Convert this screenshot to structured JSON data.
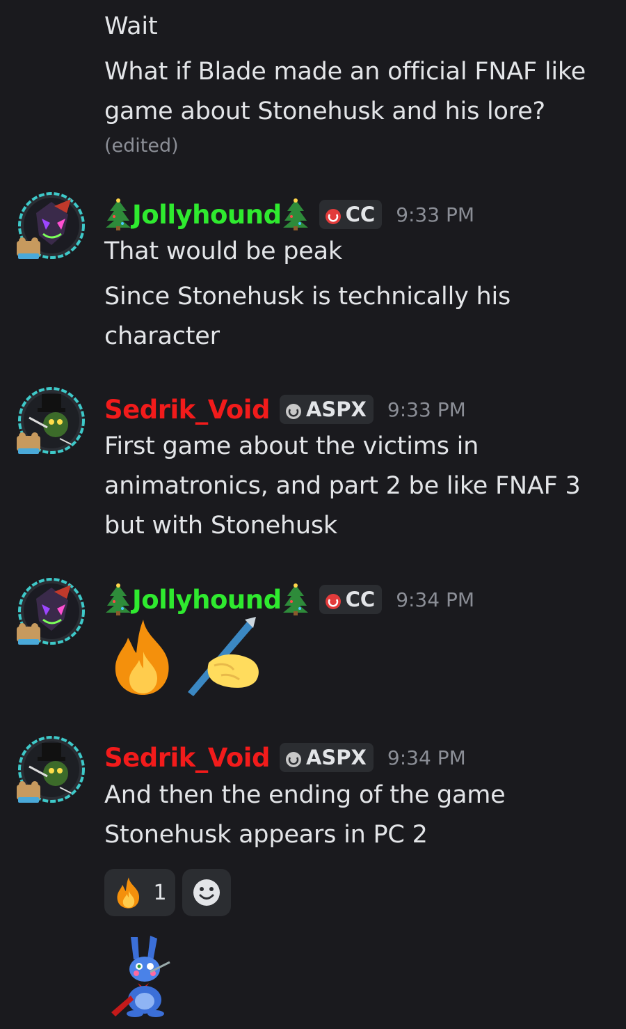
{
  "messages": [
    {
      "continuation": true,
      "lines": [
        "Wait"
      ]
    },
    {
      "continuation": true,
      "lines": [
        "What if Blade made an official FNAF like",
        "game about Stonehusk and his lore?"
      ],
      "edited": "(edited)"
    },
    {
      "author": "Jollyhound",
      "author_color": "#2fea2f",
      "tag": "CC",
      "timestamp": "9:33 PM",
      "lines": [
        "That would be peak"
      ]
    },
    {
      "continuation": true,
      "lines": [
        "Since Stonehusk is technically his",
        "character"
      ]
    },
    {
      "author": "Sedrik_Void",
      "author_color": "#f21b1b",
      "tag": "ASPX",
      "timestamp": "9:33 PM",
      "lines": [
        "First game about the victims in",
        "animatronics, and part 2 be like FNAF 3",
        "but with Stonehusk"
      ]
    },
    {
      "author": "Jollyhound",
      "author_color": "#2fea2f",
      "tag": "CC",
      "timestamp": "9:34 PM",
      "emojis": [
        "fire-emoji",
        "writing-hand-emoji"
      ]
    },
    {
      "author": "Sedrik_Void",
      "author_color": "#f21b1b",
      "tag": "ASPX",
      "timestamp": "9:34 PM",
      "lines": [
        "And then the ending of the game",
        "Stonehusk appears in PC 2"
      ]
    }
  ],
  "reactions": [
    {
      "emoji": "fire-emoji",
      "count": "1"
    },
    {
      "emoji": "add-reaction-icon"
    }
  ],
  "sticker": "toy-bonnie-sticker",
  "colors": {
    "background": "#1a1a1e",
    "jollyhound": "#2fea2f",
    "sedrik": "#f21b1b",
    "tag_bg": "#2b2d31",
    "timestamp": "#8b8e96"
  }
}
